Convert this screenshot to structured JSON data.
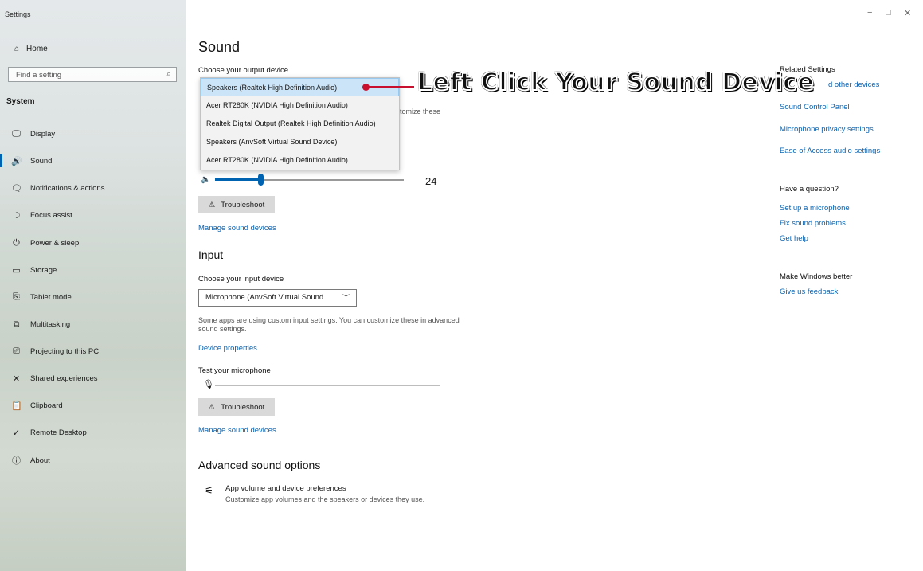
{
  "app": {
    "title": "Settings"
  },
  "window_controls": {
    "minimize_icon": "−",
    "maximize_icon": "□",
    "close_icon": "✕"
  },
  "sidebar": {
    "home": "Home",
    "search_placeholder": "Find a setting",
    "section": "System",
    "items": [
      {
        "label": "Display",
        "icon": "display-icon",
        "glyph": "🖵"
      },
      {
        "label": "Sound",
        "icon": "speaker-icon",
        "glyph": "🔊",
        "active": true
      },
      {
        "label": "Notifications & actions",
        "icon": "notification-icon",
        "glyph": "🗨"
      },
      {
        "label": "Focus assist",
        "icon": "moon-icon",
        "glyph": "☽"
      },
      {
        "label": "Power & sleep",
        "icon": "power-icon",
        "glyph": "⏻"
      },
      {
        "label": "Storage",
        "icon": "storage-icon",
        "glyph": "▭"
      },
      {
        "label": "Tablet mode",
        "icon": "tablet-icon",
        "glyph": "⎘"
      },
      {
        "label": "Multitasking",
        "icon": "multitasking-icon",
        "glyph": "⧉"
      },
      {
        "label": "Projecting to this PC",
        "icon": "projecting-icon",
        "glyph": "⎚"
      },
      {
        "label": "Shared experiences",
        "icon": "shared-icon",
        "glyph": "✕"
      },
      {
        "label": "Clipboard",
        "icon": "clipboard-icon",
        "glyph": "📋"
      },
      {
        "label": "Remote Desktop",
        "icon": "remote-icon",
        "glyph": "✓"
      },
      {
        "label": "About",
        "icon": "info-icon",
        "glyph": "ⓘ"
      }
    ]
  },
  "main": {
    "title": "Sound",
    "output": {
      "label": "Choose your output device",
      "options": [
        "Speakers (Realtek High Definition Audio)",
        "Acer RT280K (NVIDIA High Definition Audio)",
        "Realtek Digital Output (Realtek High Definition Audio)",
        "Speakers (AnvSoft Virtual Sound Device)",
        "Acer RT280K (NVIDIA High Definition Audio)"
      ],
      "hidden_text": "tomize these",
      "volume": 24,
      "volume_fraction": 0.24,
      "troubleshoot": "Troubleshoot",
      "manage": "Manage sound devices"
    },
    "input": {
      "heading": "Input",
      "label": "Choose your input device",
      "selected": "Microphone (AnvSoft Virtual Sound...",
      "note": "Some apps are using custom input settings. You can customize these in advanced sound settings.",
      "device_properties": "Device properties",
      "test_label": "Test your microphone",
      "troubleshoot": "Troubleshoot",
      "manage": "Manage sound devices"
    },
    "advanced": {
      "heading": "Advanced sound options",
      "item_title": "App volume and device preferences",
      "item_desc": "Customize app volumes and the speakers or devices they use."
    }
  },
  "related": {
    "title": "Related Settings",
    "links": [
      "d other devices",
      "Sound Control Panel",
      "Microphone privacy settings",
      "Ease of Access audio settings"
    ],
    "question_title": "Have a question?",
    "question_links": [
      "Set up a microphone",
      "Fix sound problems",
      "Get help"
    ],
    "better_title": "Make Windows better",
    "feedback": "Give us feedback"
  },
  "annotation": {
    "text": "Left Click Your Sound Device",
    "color": "#c8102e"
  }
}
